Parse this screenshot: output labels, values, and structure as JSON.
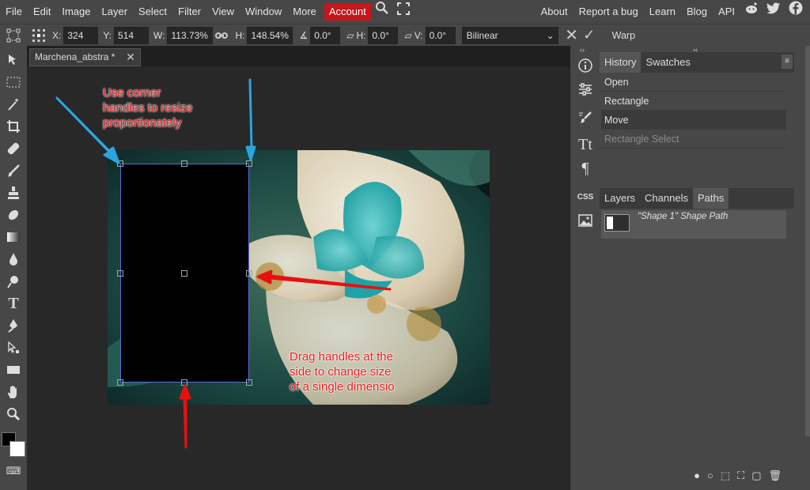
{
  "menu": {
    "items": [
      "File",
      "Edit",
      "Image",
      "Layer",
      "Select",
      "Filter",
      "View",
      "Window",
      "More"
    ],
    "account": "Account",
    "right_items": [
      "About",
      "Report a bug",
      "Learn",
      "Blog",
      "API"
    ]
  },
  "options": {
    "x_label": "X:",
    "x_value": "324 px",
    "y_label": "Y:",
    "y_value": "514 px",
    "w_label": "W:",
    "w_value": "113.73%",
    "h_label": "H:",
    "h_value": "148.54%",
    "rot_value": "0.0°",
    "skew_h_label": "H:",
    "skew_h_value": "0.0°",
    "skew_v_label": "V:",
    "skew_v_value": "0.0°",
    "interpolation": "Bilinear",
    "warp_label": "Warp"
  },
  "document": {
    "tab_title": "Marchena_abstra *"
  },
  "annotations": {
    "corner": "Use corner\nhandles to resize\nproportionately",
    "side": "Drag handles at the\nside to change size\nof a single dimensio"
  },
  "history_panel": {
    "tabs": [
      "History",
      "Swatches"
    ],
    "items": [
      {
        "label": "Open",
        "state": "normal"
      },
      {
        "label": "Rectangle",
        "state": "normal"
      },
      {
        "label": "Move",
        "state": "selected"
      },
      {
        "label": "Rectangle Select",
        "state": "dim"
      }
    ]
  },
  "layers_panel": {
    "tabs": [
      "Layers",
      "Channels",
      "Paths"
    ],
    "active_tab": "Paths",
    "path_name": "\"Shape 1\" Shape Path"
  },
  "colors": {
    "account_bg": "#c4161c",
    "annotation_red": "#e62020",
    "arrow_blue": "#2aa5e0",
    "arrow_red": "#e81010"
  }
}
